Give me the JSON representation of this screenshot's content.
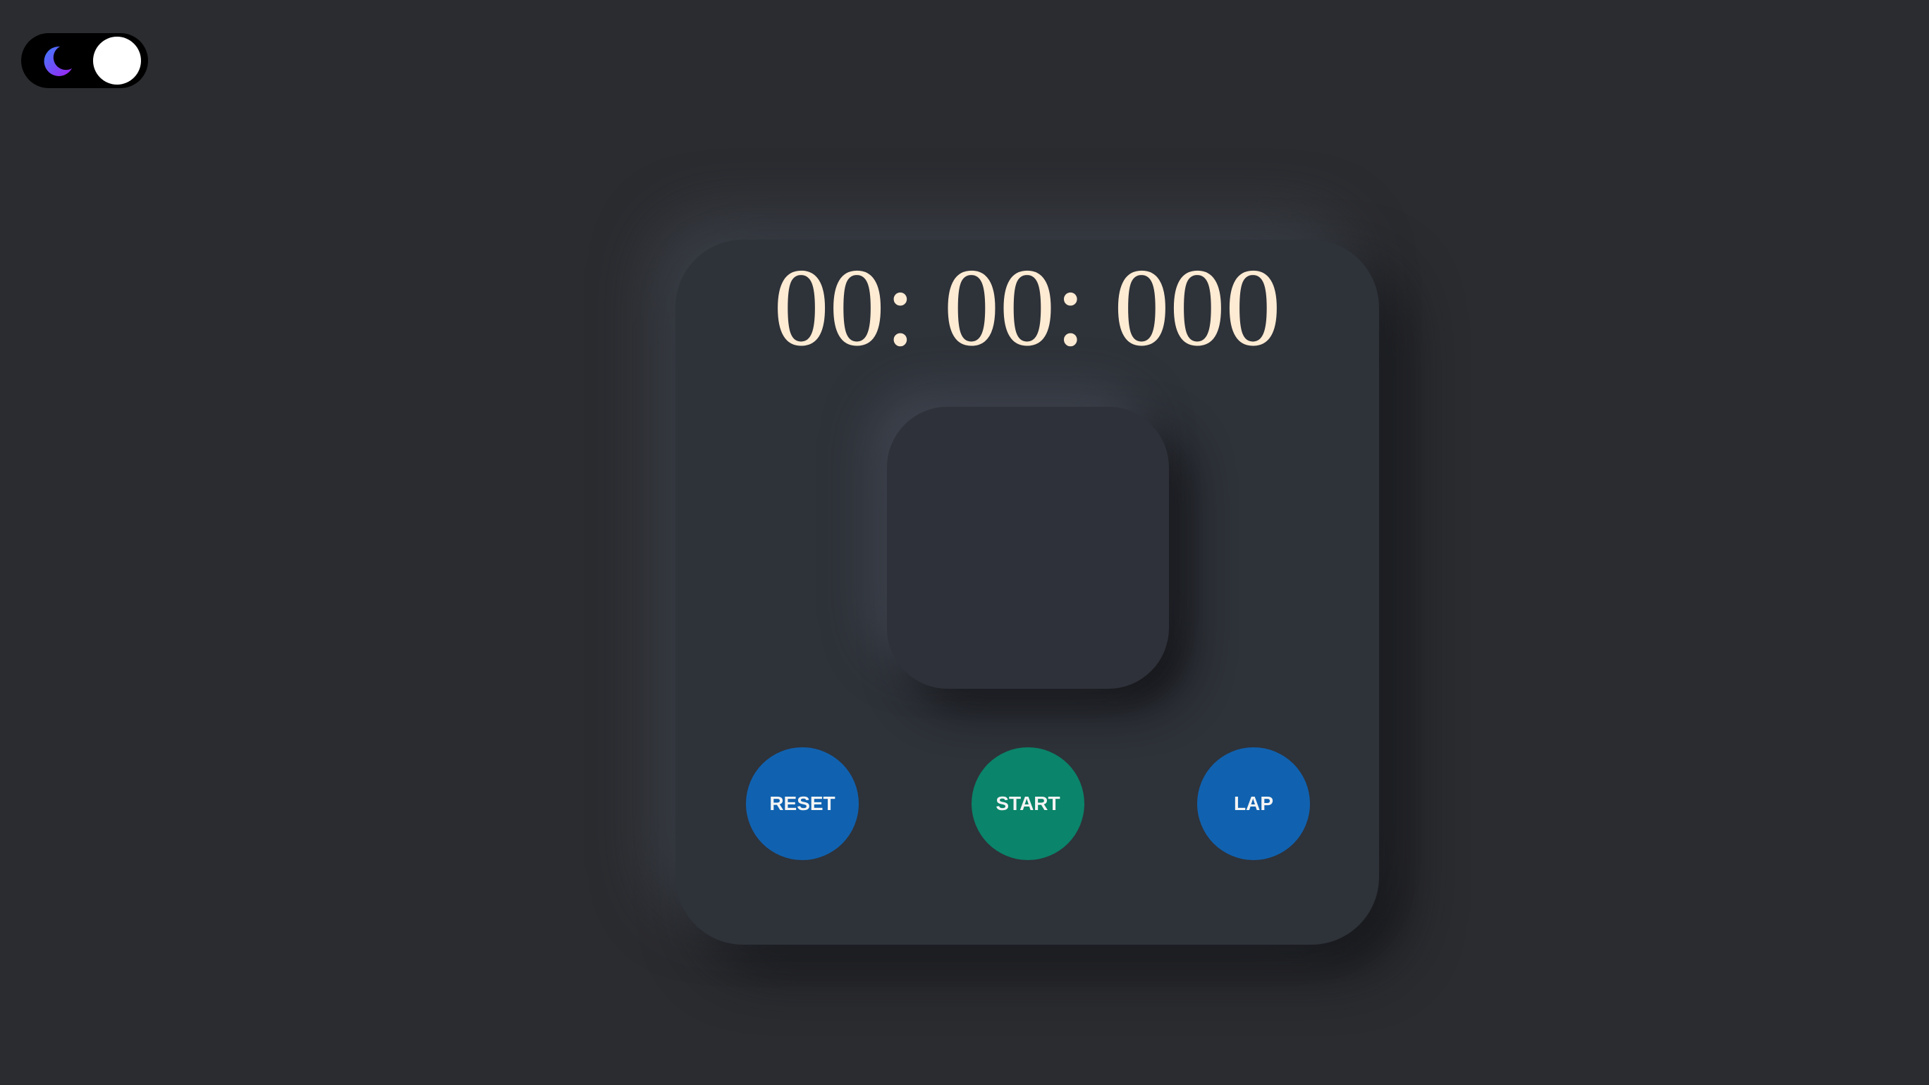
{
  "theme_toggle": {
    "icon": "moon-icon",
    "moon_gradient": [
      "#3d7dff",
      "#a020f0"
    ],
    "knob_color": "#ffffff",
    "track_color": "#000000"
  },
  "stopwatch": {
    "time": "00: 00: 000",
    "time_color": "#fdebd3",
    "card_color": "#2e3239"
  },
  "buttons": {
    "reset": {
      "label": "RESET",
      "color": "#1062b0"
    },
    "start": {
      "label": "START",
      "color": "#0a846a"
    },
    "lap": {
      "label": "LAP",
      "color": "#1062b0"
    }
  }
}
